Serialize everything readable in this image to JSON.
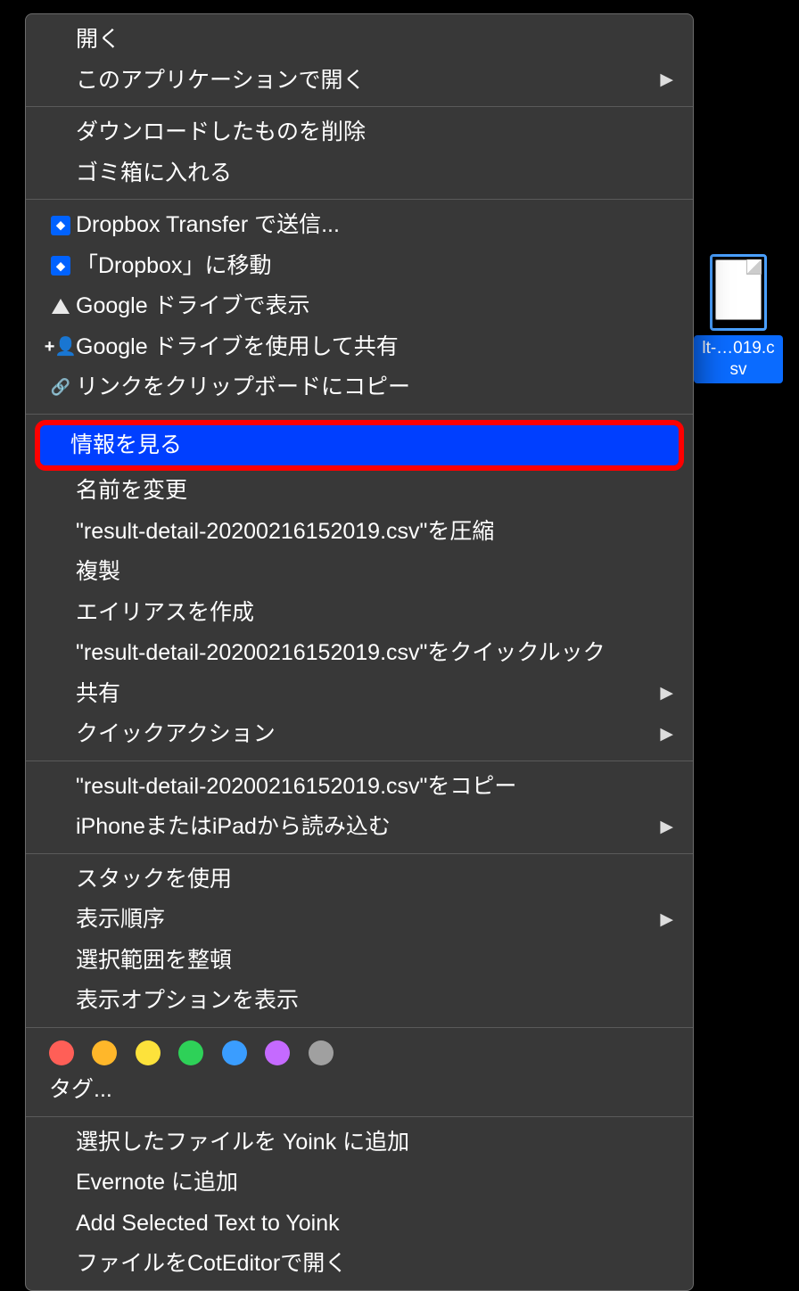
{
  "desktop_file": {
    "label_visible": "lt-…019.csv"
  },
  "menu": {
    "group1": [
      {
        "label": "開く",
        "icon": null,
        "submenu": false
      },
      {
        "label": "このアプリケーションで開く",
        "icon": null,
        "submenu": true
      }
    ],
    "group2": [
      {
        "label": "ダウンロードしたものを削除",
        "icon": null,
        "submenu": false
      },
      {
        "label": "ゴミ箱に入れる",
        "icon": null,
        "submenu": false
      }
    ],
    "group3": [
      {
        "label": "Dropbox Transfer で送信...",
        "icon": "dropbox",
        "submenu": false
      },
      {
        "label": "「Dropbox」に移動",
        "icon": "dropbox",
        "submenu": false
      },
      {
        "label": "Google ドライブで表示",
        "icon": "gdrive",
        "submenu": false
      },
      {
        "label": "Google ドライブを使用して共有",
        "icon": "share",
        "submenu": false
      },
      {
        "label": "リンクをクリップボードにコピー",
        "icon": "link",
        "submenu": false
      }
    ],
    "highlighted": {
      "label": "情報を見る"
    },
    "group4": [
      {
        "label": "名前を変更",
        "icon": null,
        "submenu": false
      },
      {
        "label": "\"result-detail-20200216152019.csv\"を圧縮",
        "icon": null,
        "submenu": false
      },
      {
        "label": "複製",
        "icon": null,
        "submenu": false
      },
      {
        "label": "エイリアスを作成",
        "icon": null,
        "submenu": false
      },
      {
        "label": "\"result-detail-20200216152019.csv\"をクイックルック",
        "icon": null,
        "submenu": false
      },
      {
        "label": "共有",
        "icon": null,
        "submenu": true
      },
      {
        "label": "クイックアクション",
        "icon": null,
        "submenu": true
      }
    ],
    "group5": [
      {
        "label": "\"result-detail-20200216152019.csv\"をコピー",
        "icon": null,
        "submenu": false
      },
      {
        "label": "iPhoneまたはiPadから読み込む",
        "icon": null,
        "submenu": true
      }
    ],
    "group6": [
      {
        "label": "スタックを使用",
        "icon": null,
        "submenu": false
      },
      {
        "label": "表示順序",
        "icon": null,
        "submenu": true
      },
      {
        "label": "選択範囲を整頓",
        "icon": null,
        "submenu": false
      },
      {
        "label": "表示オプションを表示",
        "icon": null,
        "submenu": false
      }
    ],
    "tags": {
      "colors": [
        "#ff5f57",
        "#ffb72a",
        "#fde23b",
        "#2ed158",
        "#3a9dff",
        "#c56aff",
        "#a0a0a0"
      ],
      "label": "タグ..."
    },
    "group7": [
      {
        "label": "選択したファイルを Yoink に追加",
        "icon": null,
        "submenu": false
      },
      {
        "label": "Evernote に追加",
        "icon": null,
        "submenu": false
      },
      {
        "label": "Add Selected Text to Yoink",
        "icon": null,
        "submenu": false
      },
      {
        "label": "ファイルをCotEditorで開く",
        "icon": null,
        "submenu": false
      }
    ]
  }
}
